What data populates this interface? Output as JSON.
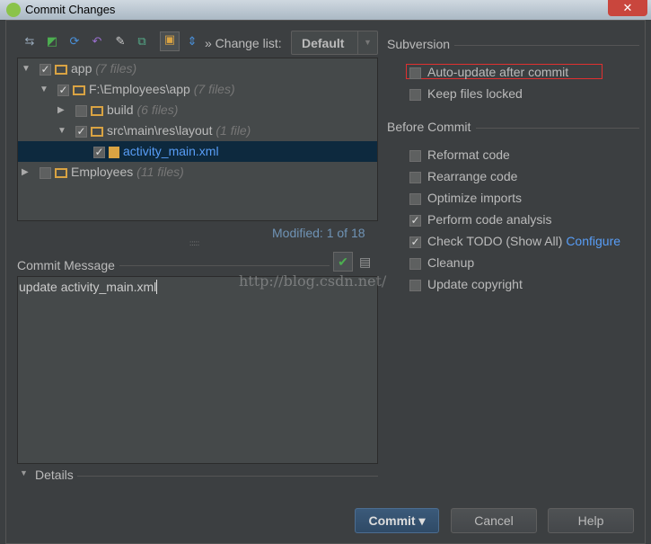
{
  "window": {
    "title": "Commit Changes",
    "close": "✕"
  },
  "toolbar": {
    "changelist_label": "» Change list:",
    "changelist_value": "Default"
  },
  "tree": [
    {
      "name": "app",
      "count": "(7 files)",
      "checked": true,
      "expanded": true
    },
    {
      "name": "F:\\Employees\\app",
      "count": "(7 files)",
      "checked": true,
      "expanded": true
    },
    {
      "name": "build",
      "count": "(6 files)",
      "checked": false,
      "expanded": false
    },
    {
      "name": "src\\main\\res\\layout",
      "count": "(1 file)",
      "checked": true,
      "expanded": true
    },
    {
      "name": "activity_main.xml",
      "count": "",
      "checked": true,
      "selected": true
    },
    {
      "name": "Employees",
      "count": "(11 files)",
      "checked": false,
      "expanded": false
    }
  ],
  "modified": "Modified: 1 of 18",
  "commit_message": {
    "label": "Commit Message",
    "value": "update activity_main.xml"
  },
  "watermark": "http://blog.csdn.net/",
  "details": "Details",
  "subversion": {
    "title": "Subversion",
    "options": [
      {
        "label": "Auto-update after commit",
        "checked": false
      },
      {
        "label": "Keep files locked",
        "checked": false
      }
    ]
  },
  "before_commit": {
    "title": "Before Commit",
    "options": [
      {
        "label": "Reformat code",
        "checked": false
      },
      {
        "label": "Rearrange code",
        "checked": false
      },
      {
        "label": "Optimize imports",
        "checked": false
      },
      {
        "label": "Perform code analysis",
        "checked": true
      },
      {
        "label": "Check TODO (Show All)",
        "checked": true,
        "link": "Configure"
      },
      {
        "label": "Cleanup",
        "checked": false
      },
      {
        "label": "Update copyright",
        "checked": false
      }
    ]
  },
  "buttons": {
    "commit": "Commit ▾",
    "cancel": "Cancel",
    "help": "Help"
  },
  "colors": {
    "accent": "#589df6",
    "selection": "#0d293e",
    "highlight_box": "#e03030"
  }
}
